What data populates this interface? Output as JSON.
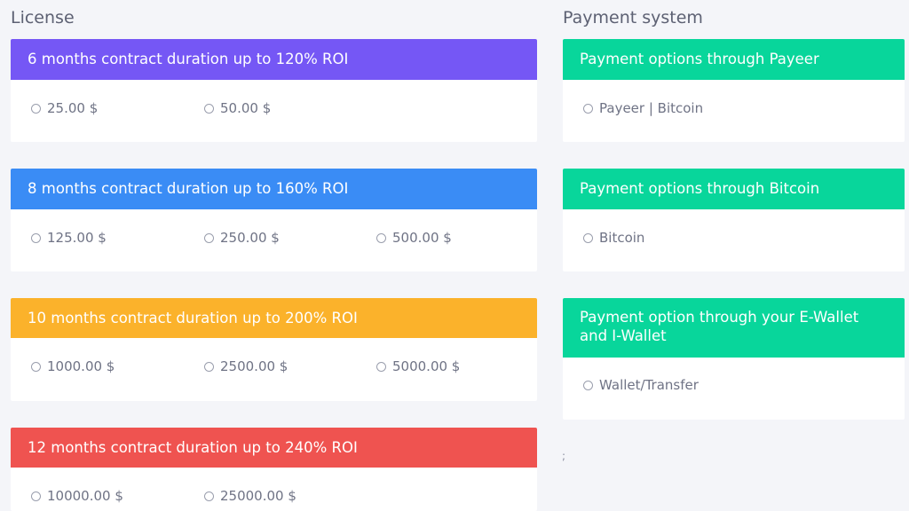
{
  "license": {
    "title": "License",
    "cards": [
      {
        "header": "6 months contract duration up to 120% ROI",
        "color": "#7557f5",
        "options": [
          "25.00 $",
          "50.00 $"
        ]
      },
      {
        "header": "8 months contract duration up to 160% ROI",
        "color": "#3a8cf5",
        "options": [
          "125.00 $",
          "250.00 $",
          "500.00 $"
        ]
      },
      {
        "header": "10 months contract duration up to 200% ROI",
        "color": "#fbb22b",
        "options": [
          "1000.00 $",
          "2500.00 $",
          "5000.00 $"
        ]
      },
      {
        "header": "12 months contract duration up to 240% ROI",
        "color": "#ef5350",
        "options": [
          "10000.00 $",
          "25000.00 $"
        ]
      }
    ]
  },
  "payment": {
    "title": "Payment system",
    "cards": [
      {
        "header": "Payment options through Payeer",
        "color": "#08d69b",
        "options": [
          "Payeer | Bitcoin"
        ]
      },
      {
        "header": "Payment options through Bitcoin",
        "color": "#08d69b",
        "options": [
          "Bitcoin"
        ]
      },
      {
        "header": "Payment option through your E-Wallet and I-Wallet",
        "color": "#08d69b",
        "options": [
          "Wallet/Transfer"
        ]
      }
    ]
  },
  "misc": {
    "semicolon": ";"
  }
}
